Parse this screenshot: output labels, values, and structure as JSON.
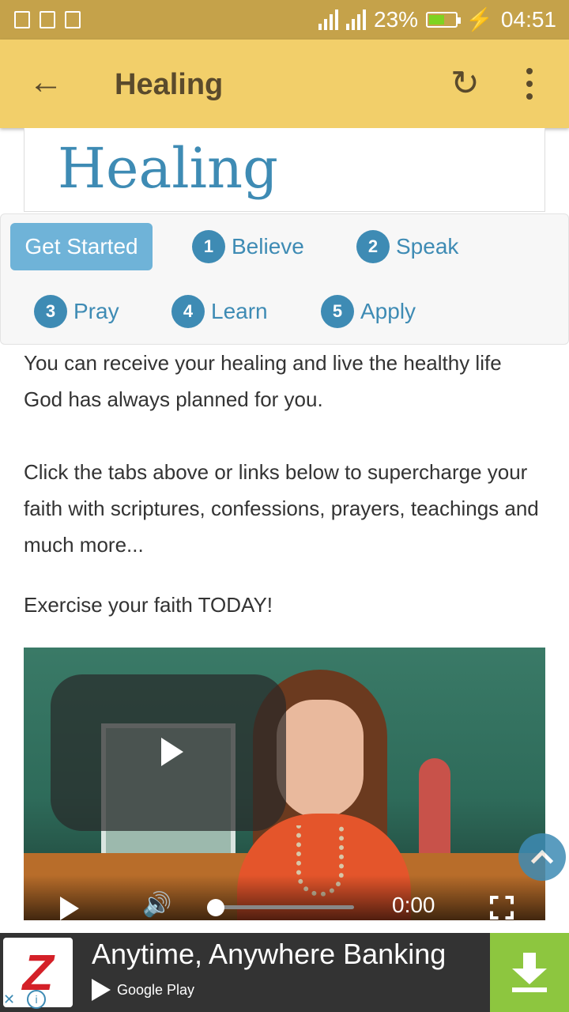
{
  "status_bar": {
    "battery": "23%",
    "time": "04:51"
  },
  "app_bar": {
    "title": "Healing"
  },
  "hero": {
    "title": "Healing"
  },
  "tabs": {
    "get_started": "Get Started",
    "items": [
      {
        "num": "1",
        "label": "Believe"
      },
      {
        "num": "2",
        "label": "Speak"
      },
      {
        "num": "3",
        "label": "Pray"
      },
      {
        "num": "4",
        "label": "Learn"
      },
      {
        "num": "5",
        "label": "Apply"
      }
    ]
  },
  "content": {
    "p1": "You can receive your healing and live the healthy life God has always planned for you.",
    "p2": "Click the tabs above or links below to supercharge your faith with scriptures, confessions, prayers, teachings and much more...",
    "p3": "Exercise your faith TODAY!"
  },
  "video": {
    "time": "0:00"
  },
  "ad": {
    "title": "Anytime, Anywhere Banking",
    "store": "Google Play",
    "logo_letter": "Z"
  },
  "colors": {
    "accent": "#3e8bb4",
    "app_bar": "#f2cf6a",
    "status_bar": "#c5a24a",
    "ad_download": "#8dc63f"
  }
}
